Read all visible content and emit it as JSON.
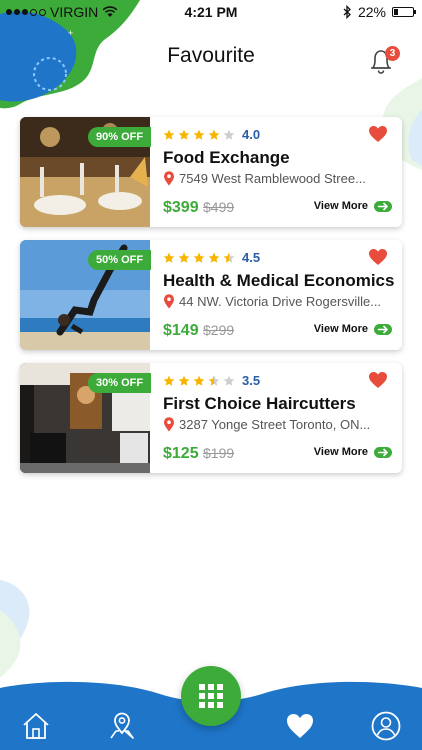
{
  "status_bar": {
    "carrier": "VIRGIN",
    "time": "4:21 PM",
    "battery_text": "22%",
    "battery_level": 0.22
  },
  "header": {
    "title": "Favourite",
    "notification_count": "3"
  },
  "cards": [
    {
      "discount": "90% OFF",
      "rating": "4.0",
      "stars": 4,
      "title": "Food Exchange",
      "address": "7549 West Ramblewood Stree...",
      "price": "$399",
      "old_price": "$499",
      "action": "View More",
      "image": "restaurant-table-photo"
    },
    {
      "discount": "50% OFF",
      "rating": "4.5",
      "stars": 4.5,
      "title": "Health & Medical Economics",
      "address": "44 NW. Victoria Drive Rogersville...",
      "price": "$149",
      "old_price": "$299",
      "action": "View More",
      "image": "yoga-beach-photo"
    },
    {
      "discount": "30% OFF",
      "rating": "3.5",
      "stars": 3.5,
      "title": "First Choice Haircutters",
      "address": "3287 Yonge Street Toronto, ON...",
      "price": "$125",
      "old_price": "$199",
      "action": "View More",
      "image": "salon-interior-photo"
    }
  ],
  "bottom_nav": {
    "items": [
      "home-icon",
      "map-pin-icon",
      "heart-icon",
      "profile-icon"
    ],
    "active": "heart-icon",
    "center": "grid-icon"
  },
  "colors": {
    "accent_green": "#3dab3a",
    "nav_blue": "#1f75c8",
    "rating_blue": "#2b5ea8",
    "heart_red": "#e74c3c",
    "star_yellow": "#f7b500"
  }
}
